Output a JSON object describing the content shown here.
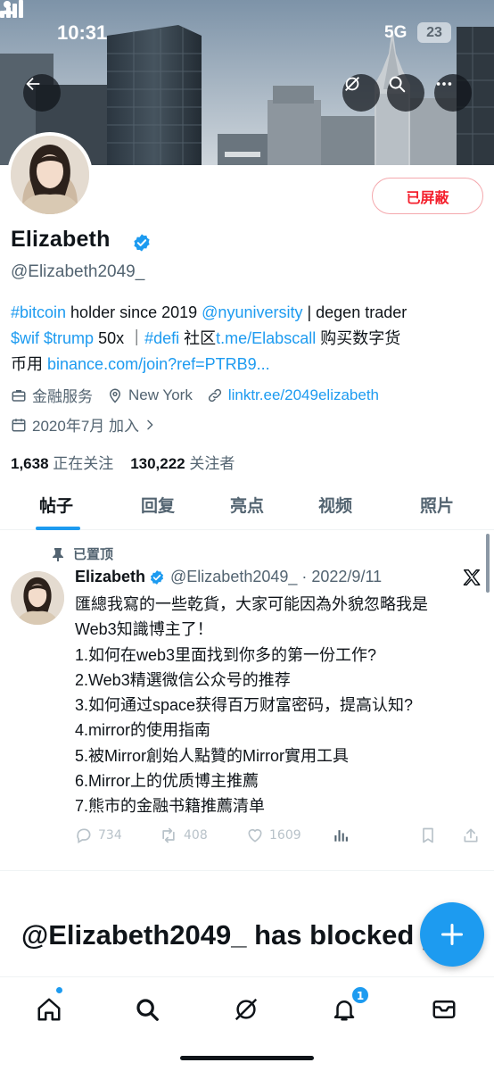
{
  "status_bar": {
    "time": "10:31",
    "network": "5G",
    "battery": "23"
  },
  "profile": {
    "name": "Elizabeth",
    "handle": "@Elizabeth2049_",
    "blocked_label": "已屏蔽",
    "bio": {
      "line1_tag": "#bitcoin",
      "line1_text1": " holder since 2019 ",
      "line1_mention": "@nyuniversity",
      "line1_text2": " | degen trader",
      "line2_tag1": "$wif",
      "line2_space": " ",
      "line2_tag2": "$trump",
      "line2_text1": " 50x ｜",
      "line2_tag3": "#defi",
      "line2_text2": " 社区",
      "line2_link": "t.me/Elabscall",
      "line2_text3": " 购买数字货",
      "line3_text": "币用 ",
      "line3_link": "binance.com/join?ref=PTRB9..."
    },
    "category": "金融服务",
    "location": "New York",
    "website": "linktr.ee/2049elizabeth",
    "joined": "2020年7月 加入",
    "following_count": "1,638",
    "following_label": "正在关注",
    "followers_count": "130,222",
    "followers_label": "关注者"
  },
  "tabs": [
    {
      "label": "帖子",
      "active": true
    },
    {
      "label": "回复",
      "active": false
    },
    {
      "label": "亮点",
      "active": false
    },
    {
      "label": "视频",
      "active": false
    },
    {
      "label": "照片",
      "active": false
    }
  ],
  "pinned_tweet": {
    "pinned_label": "已置顶",
    "author_name": "Elizabeth",
    "author_handle_date": "@Elizabeth2049_ · 2022/9/11",
    "lines": [
      "匯總我寫的一些乾貨，大家可能因為外貌忽略我是",
      "Web3知識博主了！",
      "1.如何在web3里面找到你多的第一份工作?",
      "2.Web3精選微信公众号的推荐",
      "3.如何通过space获得百万财富密码，提高认知?",
      "4.mirror的使用指南",
      "5.被Mirror創始人點贊的Mirror實用工具",
      "6.Mirror上的优质博主推薦",
      "7.熊市的金融书籍推薦清单"
    ],
    "replies": "734",
    "retweets": "408",
    "likes": "1609"
  },
  "blocked_message": "@Elizabeth2049_ has blocked you",
  "bottom_nav": {
    "notifications_badge": "1"
  },
  "colors": {
    "accent": "#1d9bf0",
    "blocked_red": "#f4212e",
    "secondary_text": "#536471"
  },
  "icons": [
    "back-arrow-icon",
    "grok-icon",
    "search-icon",
    "more-icon",
    "verified-icon",
    "briefcase-icon",
    "location-icon",
    "link-icon",
    "calendar-icon",
    "pin-icon",
    "x-logo-icon",
    "reply-icon",
    "retweet-icon",
    "like-icon",
    "views-icon",
    "bookmark-icon",
    "share-icon",
    "plus-icon",
    "home-icon",
    "bell-icon",
    "mail-icon"
  ]
}
